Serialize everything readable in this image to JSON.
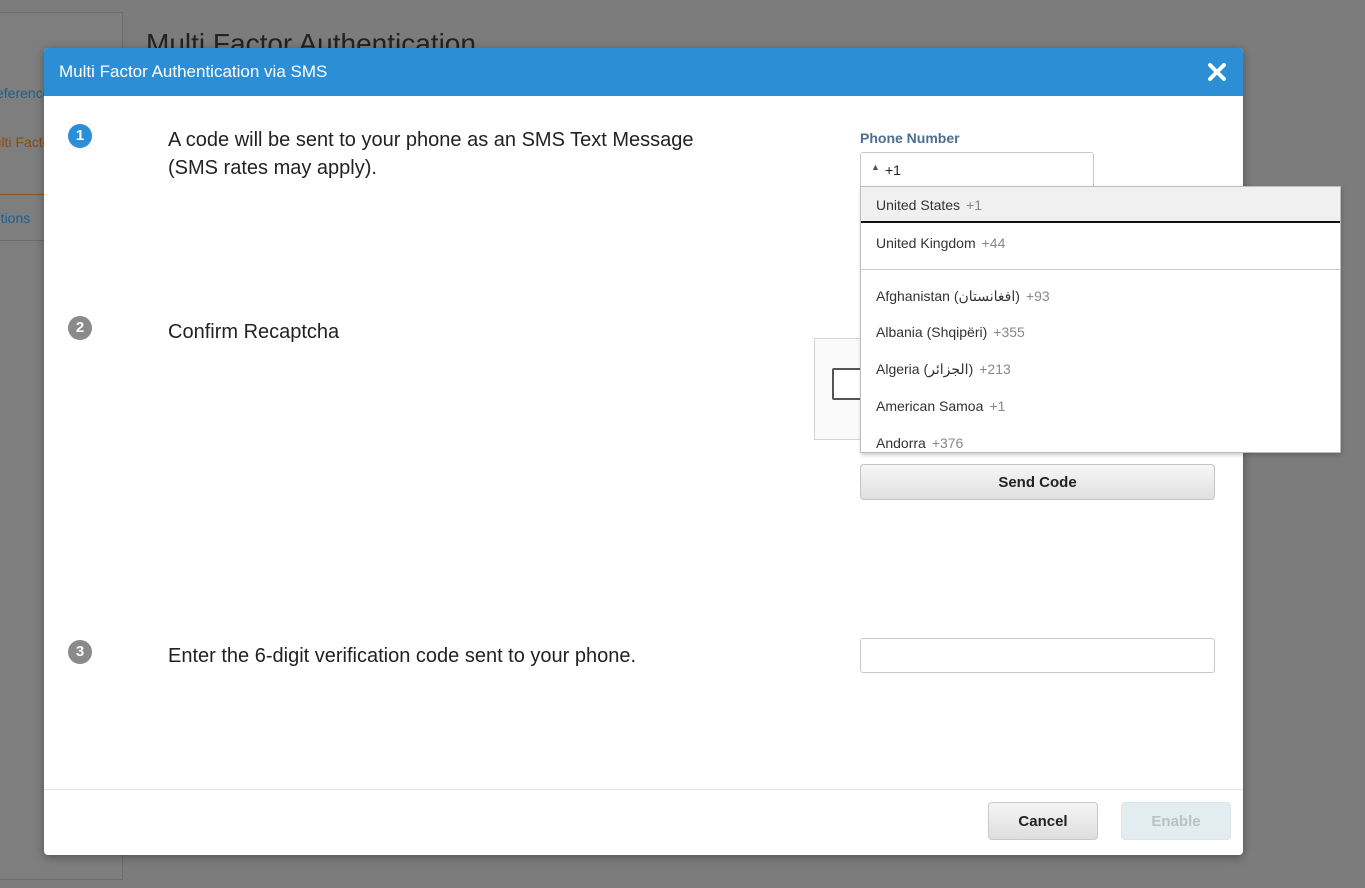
{
  "background": {
    "title": "Multi Factor Authentication",
    "sidebar_items": [
      "Preferences",
      "Multi Factor",
      "Options"
    ]
  },
  "modal": {
    "title": "Multi Factor Authentication via SMS",
    "close_icon": "close-icon",
    "steps": [
      {
        "number": "1",
        "text_line1": "A code will be sent to your phone as an SMS Text Message",
        "text_line2": "(SMS rates may apply).",
        "color": "#2c8fd6"
      },
      {
        "number": "2",
        "text": "Confirm Recaptcha",
        "color": "#8a8a8a"
      },
      {
        "number": "3",
        "text": "Enter the 6-digit verification code sent to your phone.",
        "color": "#8a8a8a"
      }
    ],
    "phone": {
      "label": "Phone Number",
      "selected_code": "+1"
    },
    "send_code_label": "Send Code",
    "code_input_value": "",
    "footer": {
      "cancel_label": "Cancel",
      "enable_label": "Enable"
    }
  },
  "dropdown": {
    "preferred": [
      {
        "name": "United States",
        "code": "+1"
      },
      {
        "name": "United Kingdom",
        "code": "+44"
      }
    ],
    "countries": [
      {
        "name": "Afghanistan (‫افغانستان‬‎)",
        "code": "+93"
      },
      {
        "name": "Albania (Shqipëri)",
        "code": "+355"
      },
      {
        "name": "Algeria (‫الجزائر‬‎)",
        "code": "+213"
      },
      {
        "name": "American Samoa",
        "code": "+1"
      },
      {
        "name": "Andorra",
        "code": "+376"
      }
    ]
  }
}
